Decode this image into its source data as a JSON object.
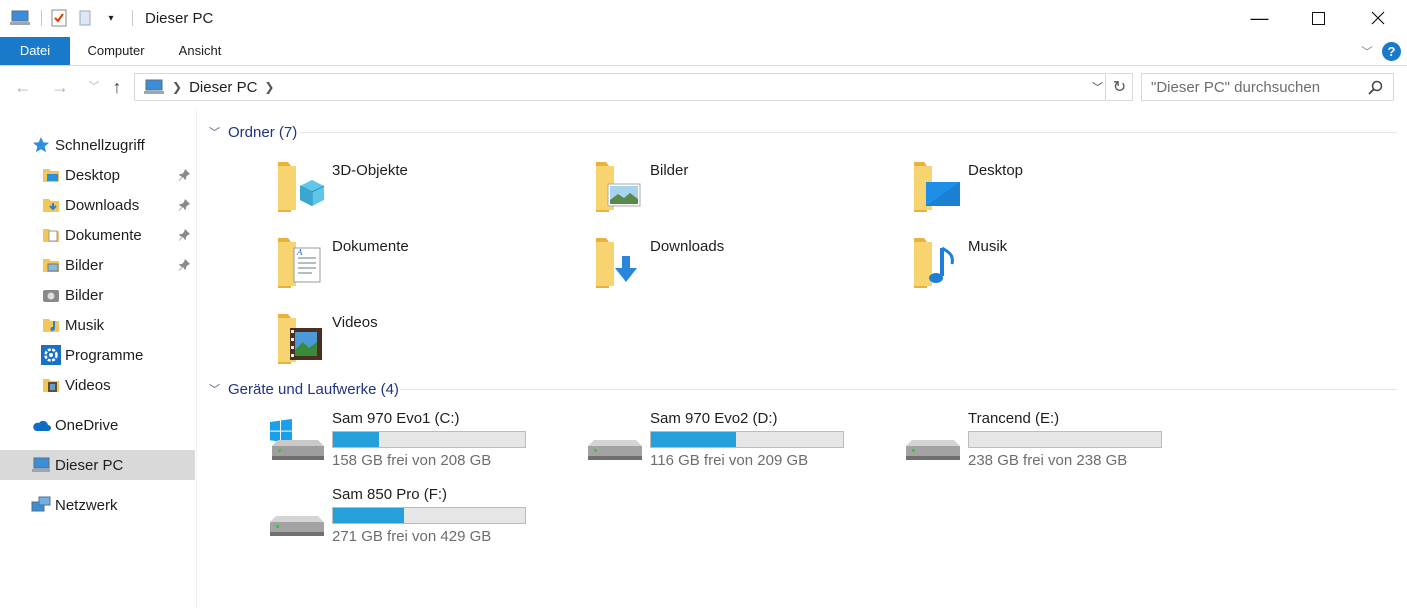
{
  "window": {
    "title": "Dieser PC"
  },
  "ribbon": {
    "tabs": [
      "Datei",
      "Computer",
      "Ansicht"
    ]
  },
  "address": {
    "location": "Dieser PC",
    "search_placeholder": "\"Dieser PC\" durchsuchen"
  },
  "sidebar": {
    "quick_access": "Schnellzugriff",
    "items": [
      {
        "label": "Desktop",
        "pinned": true
      },
      {
        "label": "Downloads",
        "pinned": true
      },
      {
        "label": "Dokumente",
        "pinned": true
      },
      {
        "label": "Bilder",
        "pinned": true
      },
      {
        "label": "Bilder",
        "pinned": false
      },
      {
        "label": "Musik",
        "pinned": false
      },
      {
        "label": "Programme",
        "pinned": false
      },
      {
        "label": "Videos",
        "pinned": false
      }
    ],
    "onedrive": "OneDrive",
    "this_pc": "Dieser PC",
    "network": "Netzwerk"
  },
  "folders_group": {
    "header": "Ordner (7)",
    "items": [
      "3D-Objekte",
      "Bilder",
      "Desktop",
      "Dokumente",
      "Downloads",
      "Musik",
      "Videos"
    ]
  },
  "drives_group": {
    "header": "Geräte und Laufwerke (4)",
    "items": [
      {
        "name": "Sam 970 Evo1 (C:)",
        "free_text": "158 GB frei von 208 GB",
        "used_fraction": 0.24
      },
      {
        "name": "Sam 970 Evo2 (D:)",
        "free_text": "116 GB frei von 209 GB",
        "used_fraction": 0.445
      },
      {
        "name": "Trancend (E:)",
        "free_text": "238 GB frei von 238 GB",
        "used_fraction": 0.0
      },
      {
        "name": "Sam 850 Pro (F:)",
        "free_text": "271 GB frei von 429 GB",
        "used_fraction": 0.368
      }
    ]
  },
  "colors": {
    "accent": "#1979ca",
    "usage_bar": "#26a0da",
    "group_header": "#1e3287",
    "selected_bg": "#d9d9d9"
  }
}
